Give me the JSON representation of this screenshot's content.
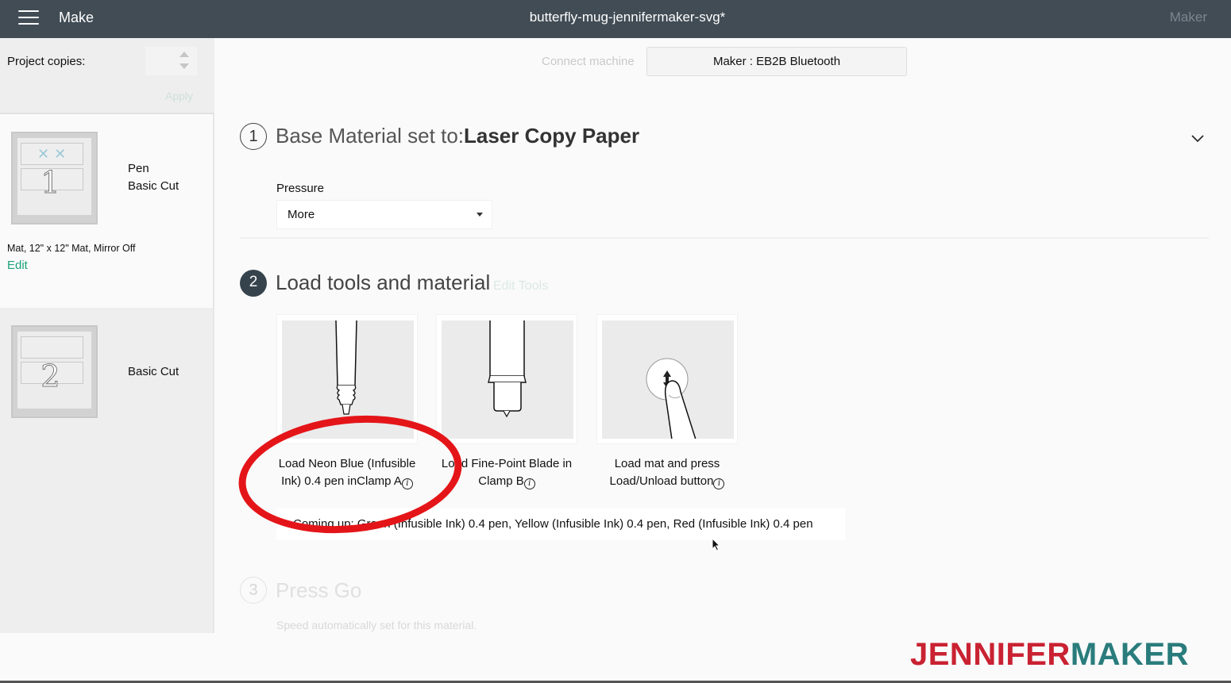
{
  "topbar": {
    "menu_icon": "hamburger-icon",
    "section": "Make",
    "document_title": "butterfly-mug-jennifermaker-svg*",
    "machine_label": "Maker"
  },
  "sidebar": {
    "copies_label": "Project copies:",
    "copies_value": "",
    "apply_label": "Apply",
    "mats": [
      {
        "number": "1",
        "lines": [
          "Pen",
          "Basic Cut"
        ],
        "info": "Mat, 12\" x 12\" Mat, Mirror Off",
        "edit_label": "Edit",
        "selected": true
      },
      {
        "number": "2",
        "lines": [
          "Basic Cut"
        ],
        "selected": false
      }
    ]
  },
  "connection": {
    "connect_label": "Connect machine",
    "machine_button": "Maker : EB2B Bluetooth"
  },
  "steps": {
    "step1": {
      "number": "1",
      "title_prefix": "Base Material set to:",
      "material": "Laser Copy Paper",
      "pressure_label": "Pressure",
      "pressure_value": "More"
    },
    "step2": {
      "number": "2",
      "title": "Load tools and material",
      "edit_tools_label": "Edit Tools",
      "cards": [
        {
          "icon": "pen-illustration",
          "label": "Load Neon Blue (Infusible Ink) 0.4 pen inClamp A"
        },
        {
          "icon": "blade-illustration",
          "label": "Load Fine-Point Blade in Clamp B"
        },
        {
          "icon": "load-button-illustration",
          "label": "Load mat and press Load/Unload button"
        }
      ],
      "info_glyph": "i",
      "coming_up": "Coming up: Green (Infusible Ink) 0.4 pen, Yellow (Infusible Ink) 0.4 pen, Red (Infusible Ink) 0.4 pen"
    },
    "step3": {
      "number": "3",
      "title": "Press Go",
      "note": "Speed automatically set for this material."
    }
  },
  "watermark": {
    "part1": "JENNIFER",
    "part2": "MAKER"
  },
  "colors": {
    "topbar": "#414c55",
    "accent_green": "#1aa37a",
    "annotation_red": "#e41519",
    "brand_red": "#c92232",
    "brand_teal": "#2a7c7c"
  }
}
